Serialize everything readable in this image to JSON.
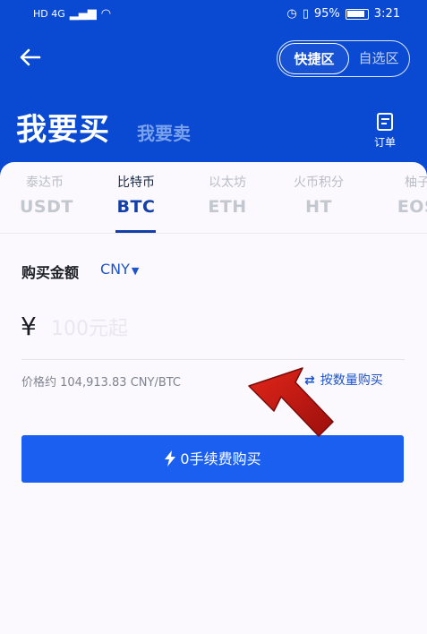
{
  "status_bar": {
    "left_text": "HD 4G",
    "battery_percent": "95%",
    "time": "3:21"
  },
  "header": {
    "back_icon": "arrow-left-icon",
    "segments": {
      "active": "快捷区",
      "inactive": "自选区"
    },
    "title": "我要买",
    "subtitle": "我要卖",
    "order_label": "订单",
    "colors": {
      "header_bg": "#0a49d1",
      "accent": "#133fa8"
    }
  },
  "tabs": [
    {
      "cn": "泰达币",
      "code": "USDT",
      "active": false
    },
    {
      "cn": "比特币",
      "code": "BTC",
      "active": true
    },
    {
      "cn": "以太坊",
      "code": "ETH",
      "active": false
    },
    {
      "cn": "火币积分",
      "code": "HT",
      "active": false
    },
    {
      "cn": "柚子",
      "code": "EOS",
      "active": false
    }
  ],
  "form": {
    "amount_label": "购买金额",
    "currency": "CNY",
    "currency_symbol": "¥",
    "amount_placeholder": "100元起",
    "price_text": "价格约 104,913.83 CNY/BTC",
    "switch_label": "按数量购买",
    "buy_button": "0手续费购买"
  }
}
